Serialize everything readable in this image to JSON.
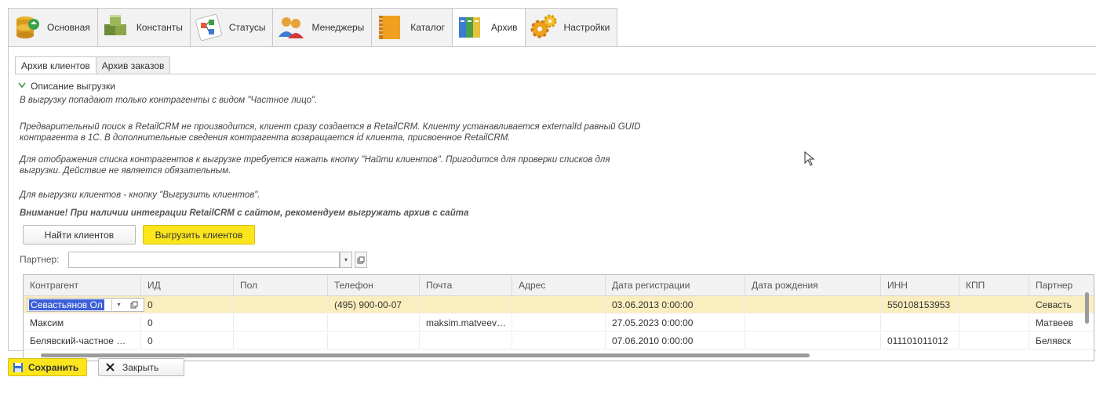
{
  "top_tabs": [
    {
      "label": "Основная",
      "icon": "database-icon"
    },
    {
      "label": "Константы",
      "icon": "blocks-icon"
    },
    {
      "label": "Статусы",
      "icon": "flow-icon"
    },
    {
      "label": "Менеджеры",
      "icon": "people-icon"
    },
    {
      "label": "Каталог",
      "icon": "book-icon"
    },
    {
      "label": "Архив",
      "icon": "archive-icon"
    },
    {
      "label": "Настройки",
      "icon": "gears-icon"
    }
  ],
  "sub_tabs": [
    "Архив клиентов",
    "Архив заказов"
  ],
  "description": {
    "title": "Описание выгрузки",
    "p1": "В выгрузку попадают только контрагенты с видом \"Частное лицо\".",
    "p2a": "Предварительный поиск в RetailCRM не производится, клиент сразу создается в RetailCRM. Клиенту устанавливается externalId равный GUID",
    "p2b": "контрагента в 1С. В дополнительные сведения контрагента возвращается id клиента, присвоенное RetailCRM.",
    "p3a": "Для отображения списка контрагентов к выгрузке требуется нажать кнопку \"Найти клиентов\". Пригодится  для проверки списков для",
    "p3b": "выгрузки. Действие не является обязательным.",
    "p4": "Для выгрузки клиентов - кнопку \"Выгрузить клиентов\".",
    "warning": "Внимание! При наличии интеграции RetailCRM с сайтом, рекомендуем выгружать архив с сайта"
  },
  "buttons": {
    "find": "Найти клиентов",
    "export": "Выгрузить клиентов"
  },
  "partner": {
    "label": "Партнер:",
    "value": ""
  },
  "table": {
    "columns": [
      "Контрагент",
      "ИД",
      "Пол",
      "Телефон",
      "Почта",
      "Адрес",
      "Дата регистрации",
      "Дата рождения",
      "ИНН",
      "КПП",
      "Партнер"
    ],
    "rows": [
      [
        "Севастьянов Ол",
        "0",
        "",
        "(495) 900-00-07",
        "",
        "",
        "03.06.2013 0:00:00",
        "",
        "550108153953",
        "",
        "Севасть"
      ],
      [
        "Максим",
        "0",
        "",
        "",
        "maksim.matveev…",
        "",
        "27.05.2023 0:00:00",
        "",
        "",
        "",
        "Матвеев"
      ],
      [
        "Белявский-частное …",
        "0",
        "",
        "",
        "",
        "",
        "07.06.2010 0:00:00",
        "",
        "011101011012",
        "",
        "Белявск"
      ]
    ]
  },
  "footer": {
    "save": "Сохранить",
    "close": "Закрыть"
  }
}
